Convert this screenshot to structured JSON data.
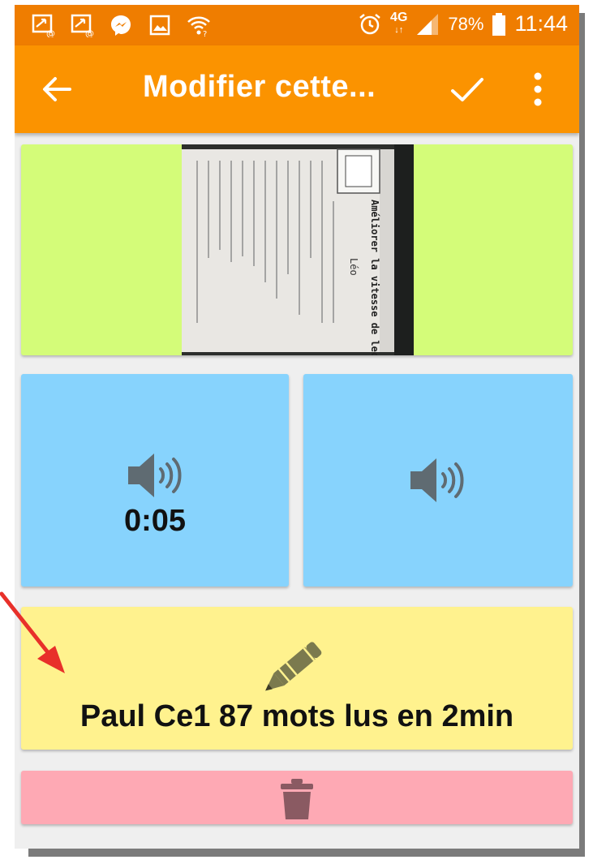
{
  "status_bar": {
    "network": "4G",
    "battery": "78%",
    "time": "11:44"
  },
  "app_bar": {
    "title": "Modifier cette..."
  },
  "audio": {
    "recording_1_duration": "0:05"
  },
  "note": {
    "text": "Paul Ce1 87 mots lus en 2min"
  },
  "photo": {
    "doc_title": "Améliorer la vitesse de lecture",
    "doc_name": "Léo"
  },
  "colors": {
    "status_bar": "#ef7d00",
    "app_bar": "#fb9300",
    "image_card": "#d4fc79",
    "audio_card": "#87d3fd",
    "text_card": "#fff28e",
    "delete_card": "#fea9b4",
    "icon_gray": "#5f6b72",
    "annotation_arrow": "#e8302a"
  }
}
